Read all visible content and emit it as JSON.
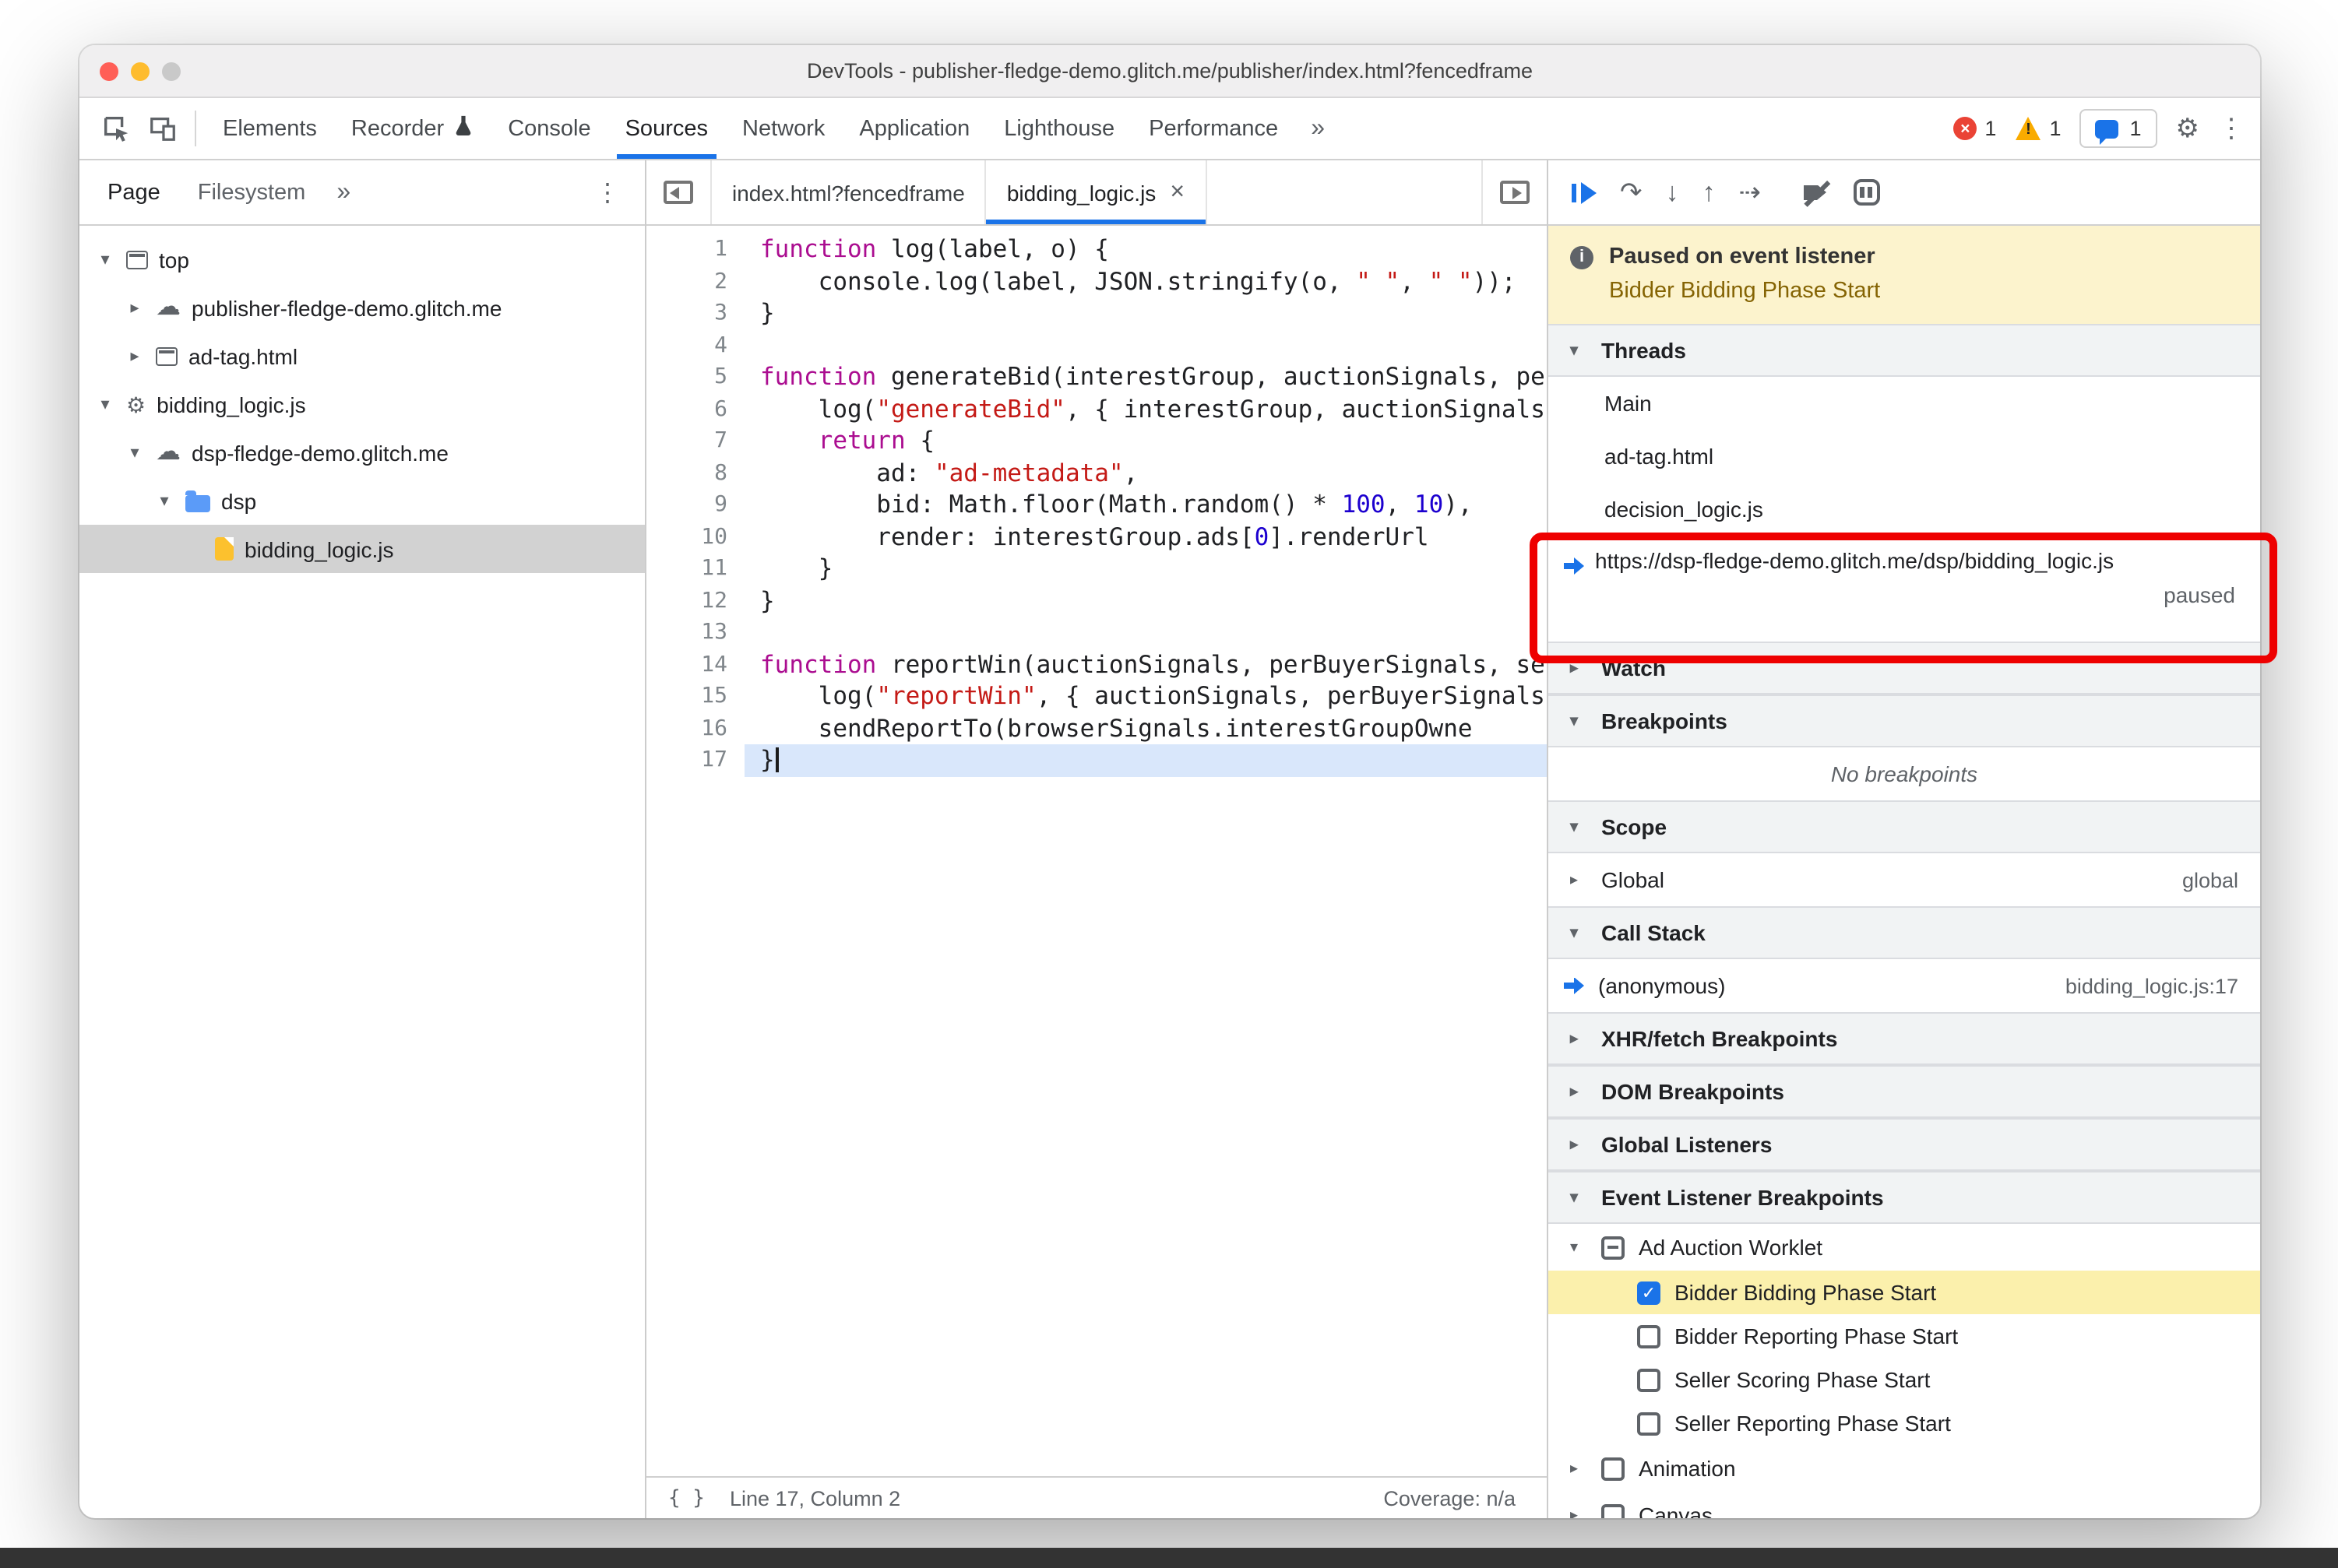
{
  "window_title": "DevTools - publisher-fledge-demo.glitch.me/publisher/index.html?fencedframe",
  "icons": {
    "close": "×",
    "more": "»",
    "kebab": "⋮",
    "cloud": "☁",
    "gear": "⚙",
    "arrow_down": "▾",
    "arrow_right": "▸",
    "check": "✓",
    "step_over": "↷",
    "step_into": "↓",
    "step_out": "↑",
    "step": "⇢",
    "braces": "{ }",
    "info": "i",
    "error_x": "×"
  },
  "colors": {
    "accent": "#1a73e8",
    "error": "#ea4335",
    "warning": "#f9ab00",
    "annotation": "#ee0000",
    "paused_banner": "#fcf3cd",
    "exec_line": "#d9e7fb",
    "selected_row": "#d2d2d2",
    "elb_highlight": "#fbf0ac"
  },
  "chrome_toolbar": {
    "tabs": [
      {
        "label": "Elements"
      },
      {
        "label": "Recorder",
        "flask": true
      },
      {
        "label": "Console"
      },
      {
        "label": "Sources",
        "active": true
      },
      {
        "label": "Network"
      },
      {
        "label": "Application"
      },
      {
        "label": "Lighthouse"
      },
      {
        "label": "Performance"
      }
    ],
    "more": "»",
    "error_count": "1",
    "warning_count": "1",
    "issues_count": "1"
  },
  "sidebar": {
    "tabs": [
      {
        "label": "Page",
        "active": true
      },
      {
        "label": "Filesystem",
        "active": false
      }
    ],
    "more": "»",
    "tree": [
      {
        "depth": 0,
        "arrow": "down",
        "icon": "frame",
        "label": "top"
      },
      {
        "depth": 1,
        "arrow": "right",
        "icon": "cloud",
        "label": "publisher-fledge-demo.glitch.me"
      },
      {
        "depth": 1,
        "arrow": "right",
        "icon": "frame",
        "label": "ad-tag.html"
      },
      {
        "depth": 0,
        "arrow": "down",
        "icon": "gear",
        "label": "bidding_logic.js"
      },
      {
        "depth": 1,
        "arrow": "down",
        "icon": "cloud",
        "label": "dsp-fledge-demo.glitch.me"
      },
      {
        "depth": 2,
        "arrow": "down",
        "icon": "folder",
        "label": "dsp"
      },
      {
        "depth": 3,
        "arrow": "none",
        "icon": "file",
        "label": "bidding_logic.js",
        "selected": true
      }
    ]
  },
  "editor": {
    "tabs": [
      {
        "label": "index.html?fencedframe",
        "active": false
      },
      {
        "label": "bidding_logic.js",
        "active": true,
        "closable": true
      }
    ],
    "current_line": 17,
    "lines": [
      {
        "n": 1,
        "toks": [
          [
            "k",
            "function"
          ],
          [
            "d",
            " log(label, o) {"
          ]
        ]
      },
      {
        "n": 2,
        "toks": [
          [
            "d",
            "    console.log(label, JSON.stringify(o, "
          ],
          [
            "s",
            "\" \""
          ],
          [
            "d",
            ", "
          ],
          [
            "s",
            "\" \""
          ],
          [
            "d",
            "));"
          ]
        ]
      },
      {
        "n": 3,
        "toks": [
          [
            "d",
            "}"
          ]
        ]
      },
      {
        "n": 4,
        "toks": []
      },
      {
        "n": 5,
        "toks": [
          [
            "k",
            "function"
          ],
          [
            "d",
            " generateBid(interestGroup, auctionSignals, perBuyerSignals, trustedBiddingSignals, browserSignals) {"
          ]
        ]
      },
      {
        "n": 6,
        "toks": [
          [
            "d",
            "    log("
          ],
          [
            "s",
            "\"generateBid\""
          ],
          [
            "d",
            ", { interestGroup, auctionSignals, perBuyerSignals, trustedBiddingSignals, browserSignals });"
          ]
        ]
      },
      {
        "n": 7,
        "toks": [
          [
            "d",
            "    "
          ],
          [
            "k",
            "return"
          ],
          [
            "d",
            " {"
          ]
        ]
      },
      {
        "n": 8,
        "toks": [
          [
            "d",
            "        ad: "
          ],
          [
            "s",
            "\"ad-metadata\""
          ],
          [
            "d",
            ","
          ]
        ]
      },
      {
        "n": 9,
        "toks": [
          [
            "d",
            "        bid: Math.floor(Math.random() * "
          ],
          [
            "n",
            "100"
          ],
          [
            "d",
            ", "
          ],
          [
            "n",
            "10"
          ],
          [
            "d",
            "),"
          ]
        ]
      },
      {
        "n": 10,
        "toks": [
          [
            "d",
            "        render: interestGroup.ads["
          ],
          [
            "n",
            "0"
          ],
          [
            "d",
            "].renderUrl"
          ]
        ]
      },
      {
        "n": 11,
        "toks": [
          [
            "d",
            "    }"
          ]
        ]
      },
      {
        "n": 12,
        "toks": [
          [
            "d",
            "}"
          ]
        ]
      },
      {
        "n": 13,
        "toks": []
      },
      {
        "n": 14,
        "toks": [
          [
            "k",
            "function"
          ],
          [
            "d",
            " reportWin(auctionSignals, perBuyerSignals, sellerSignals, browserSignals) {"
          ]
        ]
      },
      {
        "n": 15,
        "toks": [
          [
            "d",
            "    log("
          ],
          [
            "s",
            "\"reportWin\""
          ],
          [
            "d",
            ", { auctionSignals, perBuyerSignals, sellerSignals, browserSignals });"
          ]
        ]
      },
      {
        "n": 16,
        "toks": [
          [
            "d",
            "    sendReportTo(browserSignals.interestGroupOwne"
          ]
        ]
      },
      {
        "n": 17,
        "toks": [
          [
            "d",
            "}"
          ]
        ]
      }
    ],
    "status_left": "Line 17, Column 2",
    "status_right": "Coverage: n/a"
  },
  "debugger": {
    "banner_title": "Paused on event listener",
    "banner_detail": "Bidder Bidding Phase Start",
    "threads_label": "Threads",
    "threads": [
      {
        "label": "Main"
      },
      {
        "label": "ad-tag.html"
      },
      {
        "label": "decision_logic.js"
      },
      {
        "label": "https://dsp-fledge-demo.glitch.me/dsp/bidding_logic.js",
        "status": "paused",
        "current": true
      }
    ],
    "watch_label": "Watch",
    "breakpoints_label": "Breakpoints",
    "breakpoints_empty": "No breakpoints",
    "scope_label": "Scope",
    "scope_rows": [
      {
        "label": "Global",
        "value": "global"
      }
    ],
    "callstack_label": "Call Stack",
    "callstack_rows": [
      {
        "label": "(anonymous)",
        "location": "bidding_logic.js:17",
        "current": true
      }
    ],
    "xhr_label": "XHR/fetch Breakpoints",
    "dom_label": "DOM Breakpoints",
    "global_listeners_label": "Global Listeners",
    "elb_label": "Event Listener Breakpoints",
    "elb_groups": [
      {
        "label": "Ad Auction Worklet",
        "expanded": true,
        "checkbox": "indeterminate",
        "children": [
          {
            "label": "Bidder Bidding Phase Start",
            "checked": true,
            "highlighted": true
          },
          {
            "label": "Bidder Reporting Phase Start",
            "checked": false
          },
          {
            "label": "Seller Scoring Phase Start",
            "checked": false
          },
          {
            "label": "Seller Reporting Phase Start",
            "checked": false
          }
        ]
      },
      {
        "label": "Animation",
        "expanded": false,
        "checkbox": "unchecked"
      },
      {
        "label": "Canvas",
        "expanded": false,
        "checkbox": "unchecked"
      }
    ]
  }
}
